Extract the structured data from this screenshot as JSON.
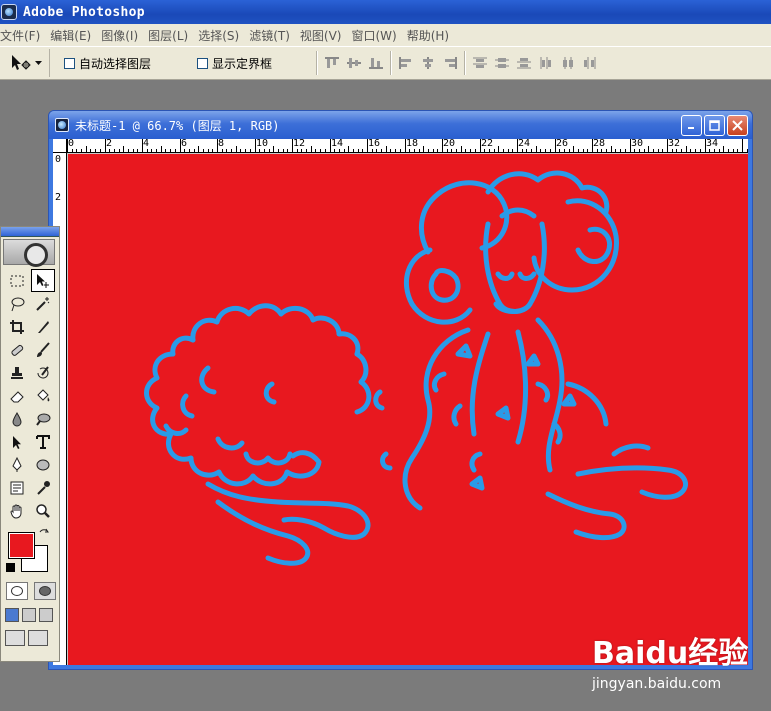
{
  "app": {
    "title": "Adobe Photoshop"
  },
  "menu": [
    "文件(F)",
    "编辑(E)",
    "图像(I)",
    "图层(L)",
    "选择(S)",
    "滤镜(T)",
    "视图(V)",
    "窗口(W)",
    "帮助(H)"
  ],
  "options": {
    "auto_select_layer": "自动选择图层",
    "show_bounding_box": "显示定界框",
    "auto_select_checked": false,
    "bbox_checked": false
  },
  "document": {
    "title": "未标题-1 @ 66.7% (图层 1, RGB)",
    "canvas_color": "#e8181f",
    "outline_color": "#2a9be8",
    "ruler_top": [
      "0",
      "2",
      "4",
      "6",
      "8",
      "10",
      "12",
      "14",
      "16",
      "18",
      "20",
      "22",
      "24",
      "26",
      "28",
      "30",
      "32",
      "34"
    ],
    "ruler_left": [
      "0",
      "2"
    ]
  },
  "toolbox": {
    "tools": [
      "marquee-icon",
      "move-icon",
      "lasso-icon",
      "magic-wand-icon",
      "crop-icon",
      "slice-icon",
      "healing-brush-icon",
      "brush-icon",
      "clone-stamp-icon",
      "history-brush-icon",
      "eraser-icon",
      "paint-bucket-icon",
      "blur-icon",
      "dodge-icon",
      "path-select-icon",
      "type-icon",
      "pen-icon",
      "ellipse-icon",
      "notes-icon",
      "eyedropper-icon",
      "hand-icon",
      "zoom-icon"
    ],
    "foreground_color": "#e8181f",
    "background_color": "#ffffff"
  },
  "watermark": {
    "brand": "Baidu经验",
    "url": "jingyan.baidu.com"
  }
}
